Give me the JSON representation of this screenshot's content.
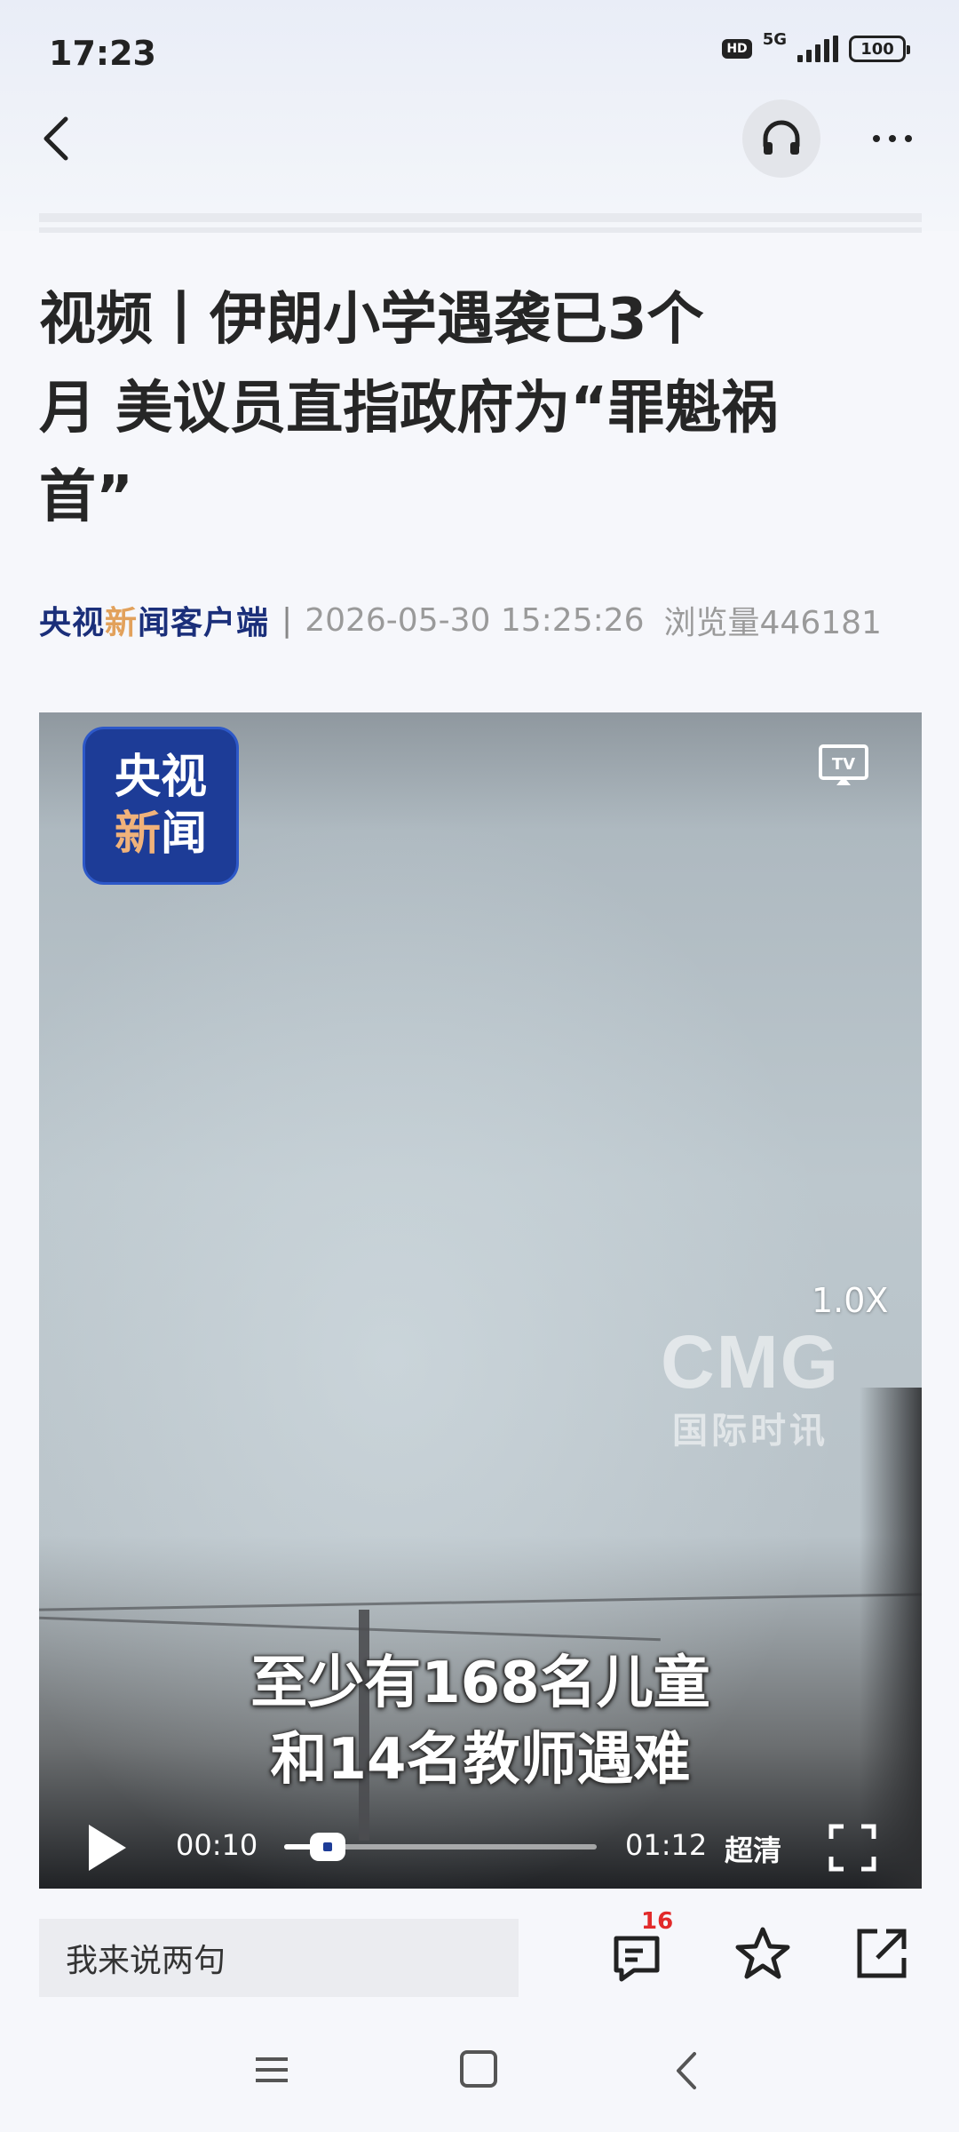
{
  "status_bar": {
    "time": "17:23",
    "hd": "HD",
    "network": "5G",
    "battery": "100"
  },
  "nav": {
    "back_icon": "chevron-left-icon",
    "audio_icon": "headphones-icon",
    "more_icon": "more-dots-icon"
  },
  "article": {
    "headline_line1": "视频丨伊朗小学遇袭已3个",
    "headline_line2": "月 美议员直指政府为“罪魁祸",
    "headline_line3": "首”",
    "source_part1": "央视",
    "source_highlight": "新",
    "source_part2": "闻客户端",
    "separator": "|",
    "date": "2026-05-30 15:25:26",
    "views": "浏览量446181"
  },
  "video": {
    "logo_line1": "央视",
    "logo_line2_highlight": "新",
    "logo_line2_rest": "闻",
    "speed": "1.0X",
    "watermark_big": "CMG",
    "watermark_small": "国际时讯",
    "subtitle_line1": "至少有168名儿童",
    "subtitle_line2": "和14名教师遇难",
    "current_time": "00:10",
    "total_time": "01:12",
    "progress_fraction": 0.139,
    "quality": "超清"
  },
  "bottom_bar": {
    "comment_placeholder": "我来说两句",
    "comment_count": "16"
  },
  "colors": {
    "brand_blue": "#1d3c97",
    "brand_orange": "#e2a15b",
    "badge_red": "#e22a2a"
  }
}
